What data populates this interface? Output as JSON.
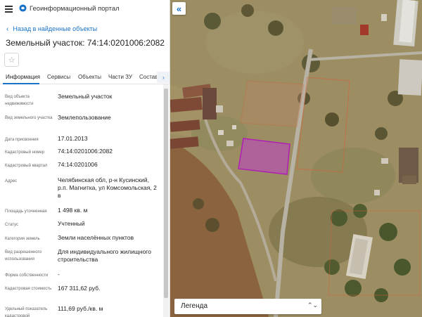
{
  "app": {
    "title": "Геоинформационный портал",
    "menu_icon": "hamburger-menu-icon",
    "logo_icon": "portal-logo-icon"
  },
  "navigation": {
    "back_label": "Назад в найденные объекты"
  },
  "object": {
    "title": "Земельный участок: 74:14:0201006:2082",
    "favorite_icon": "star-icon"
  },
  "tabs": [
    {
      "label": "Информация",
      "active": true
    },
    {
      "label": "Сервисы",
      "active": false
    },
    {
      "label": "Объекты",
      "active": false
    },
    {
      "label": "Части ЗУ",
      "active": false
    },
    {
      "label": "Состав",
      "active": false
    }
  ],
  "tabs_more": "›",
  "properties": [
    {
      "label": "Вид объекта недвижимости",
      "value": "Земельный участок"
    },
    {
      "label": "Вид земельного участка",
      "value": "Землепользование"
    },
    {
      "label": "Дата присвоения",
      "value": "17.01.2013"
    },
    {
      "label": "Кадастровый номер",
      "value": "74:14:0201006:2082"
    },
    {
      "label": "Кадастровый квартал",
      "value": "74:14:0201006"
    },
    {
      "label": "Адрес",
      "value": "Челябинская обл, р-н Кусинский, р.п. Магнитка, ул Комсомольская, 2 в"
    },
    {
      "label": "Площадь уточненная",
      "value": "1 498 кв. м"
    },
    {
      "label": "Статус",
      "value": "Учтенный"
    },
    {
      "label": "Категория земель",
      "value": "Земли населённых пунктов"
    },
    {
      "label": "Вид разрешенного использования",
      "value": "Для индивидуального жилищного строительства"
    },
    {
      "label": "Форма собственности",
      "value": "-"
    },
    {
      "label": "Кадастровая стоимость",
      "value": "167 311,62 руб."
    },
    {
      "label": "Удельный показатель кадастровой",
      "value": "111,69 руб./кв. м"
    }
  ],
  "map": {
    "collapse_label": "«",
    "legend_label": "Легенда",
    "legend_arrows": "⌃⌄",
    "parcel_color": "#c040c8",
    "neighbor_outline_color": "#d9603a"
  },
  "colors": {
    "accent": "#1a73c7"
  }
}
